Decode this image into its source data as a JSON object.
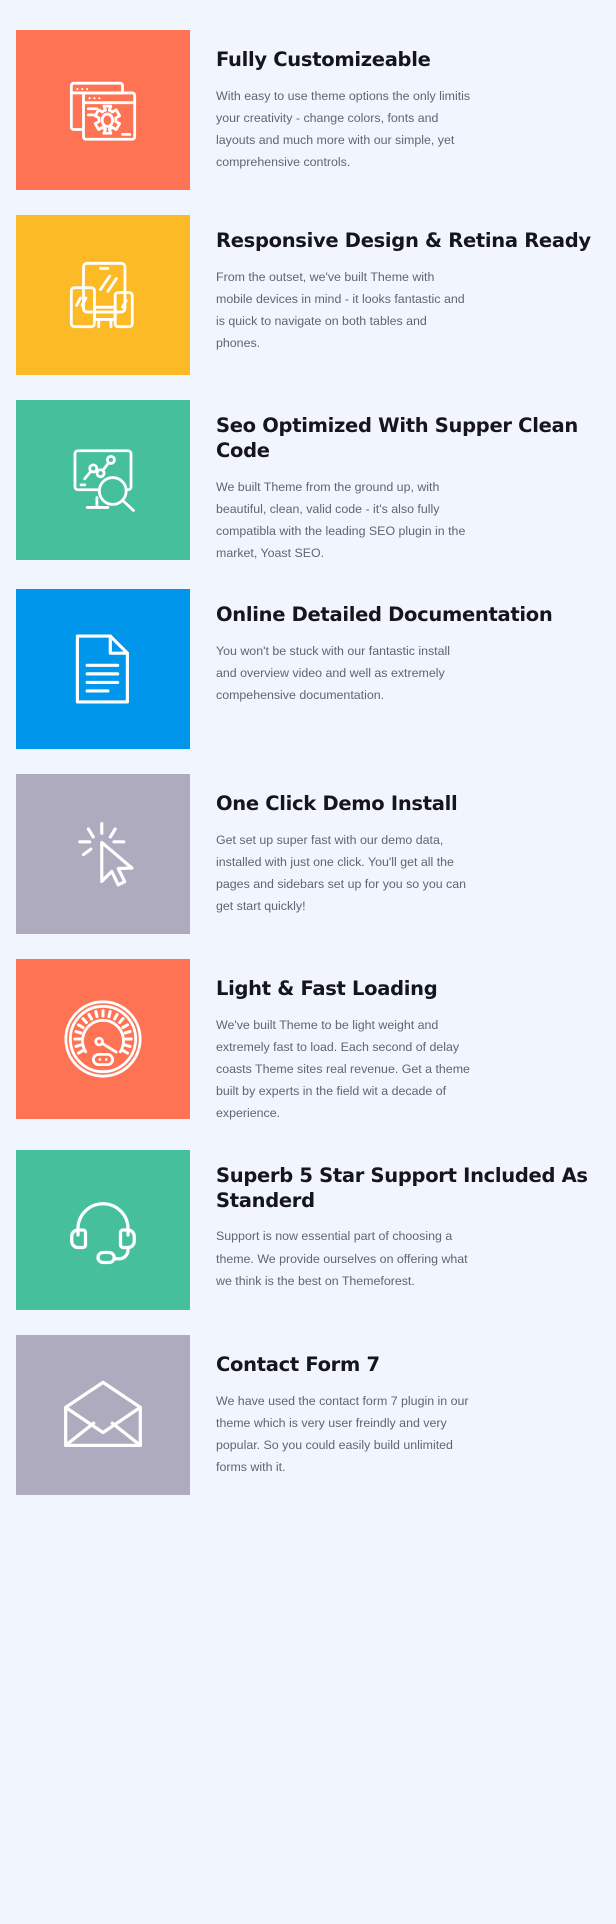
{
  "page": {
    "background_color": "#f1f5fe",
    "title_color": "#15151b",
    "body_color": "#5f6573"
  },
  "features": [
    {
      "id": "fully-customizeable",
      "icon": "browser-windows-gear-icon",
      "tile_color": "#fd7354",
      "title": "Fully Customizeable",
      "description": "With easy to use theme options the only limitis your creativity - change colors, fonts and layouts and much more with our simple, yet comprehensive controls."
    },
    {
      "id": "responsive-design-retina-ready",
      "icon": "responsive-devices-icon",
      "tile_color": "#fdba27",
      "title": "Responsive Design & Retina Ready",
      "description": "From the outset, we've built Theme with mobile devices in mind - it looks fantastic and is quick to navigate on both tables and phones."
    },
    {
      "id": "seo-optimized-clean-code",
      "icon": "analytics-search-icon",
      "tile_color": "#45bf9c",
      "title": "Seo Optimized With Supper Clean Code",
      "description": "We built Theme from the ground up, with beautiful, clean, valid code - it's also fully compatibla with the leading SEO plugin in the market, Yoast SEO."
    },
    {
      "id": "online-detailed-documentation",
      "icon": "document-page-icon",
      "tile_color": "#0096ec",
      "title": "Online Detailed Documentation",
      "description": "You won't be stuck with our fantastic install and overview video and well as extremely compehensive documentation."
    },
    {
      "id": "one-click-demo-install",
      "icon": "cursor-click-icon",
      "tile_color": "#aeabbe",
      "title": "One Click Demo Install",
      "description": "Get set up super fast with our demo data, installed with just one click. You'll get all the pages and sidebars set up for you so you can get start quickly!"
    },
    {
      "id": "light-fast-loading",
      "icon": "speedometer-gauge-icon",
      "tile_color": "#fd7354",
      "title": "Light & Fast Loading",
      "description": "We've built Theme to be light weight and extremely fast to load. Each second of delay coasts Theme sites real revenue. Get a theme built by experts in the field wit a decade of experience."
    },
    {
      "id": "superb-5-star-support",
      "icon": "headset-support-icon",
      "tile_color": "#45bf9c",
      "title": "Superb 5 Star Support Included As Standerd",
      "description": "Support is now essential part of choosing a theme. We provide ourselves on offering what we think is the best on Themeforest."
    },
    {
      "id": "contact-form-7",
      "icon": "open-envelope-icon",
      "tile_color": "#aeabbe",
      "title": "Contact Form 7",
      "description": "We have used the contact form 7 plugin in our theme which is very user freindly and very popular. So you could easily build unlimited forms with it."
    }
  ]
}
